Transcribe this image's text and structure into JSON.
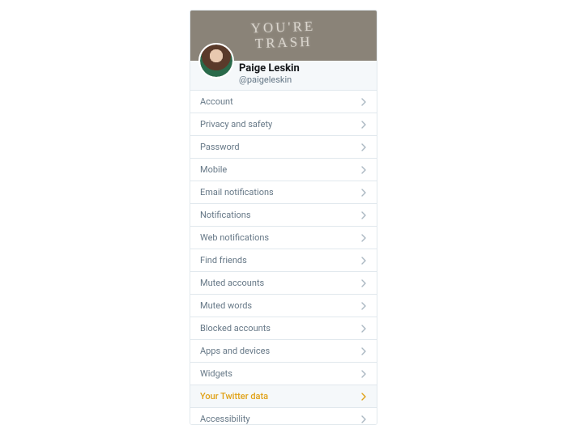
{
  "profile": {
    "banner_text": "YOU'RE\nTRASH",
    "display_name": "Paige Leskin",
    "handle": "@paigeleskin"
  },
  "menu": {
    "items": [
      {
        "label": "Account",
        "active": false
      },
      {
        "label": "Privacy and safety",
        "active": false
      },
      {
        "label": "Password",
        "active": false
      },
      {
        "label": "Mobile",
        "active": false
      },
      {
        "label": "Email notifications",
        "active": false
      },
      {
        "label": "Notifications",
        "active": false
      },
      {
        "label": "Web notifications",
        "active": false
      },
      {
        "label": "Find friends",
        "active": false
      },
      {
        "label": "Muted accounts",
        "active": false
      },
      {
        "label": "Muted words",
        "active": false
      },
      {
        "label": "Blocked accounts",
        "active": false
      },
      {
        "label": "Apps and devices",
        "active": false
      },
      {
        "label": "Widgets",
        "active": false
      },
      {
        "label": "Your Twitter data",
        "active": true
      },
      {
        "label": "Accessibility",
        "active": false
      }
    ]
  },
  "colors": {
    "accent": "#e0a116",
    "text_muted": "#657786",
    "border": "#e1e8ed"
  }
}
